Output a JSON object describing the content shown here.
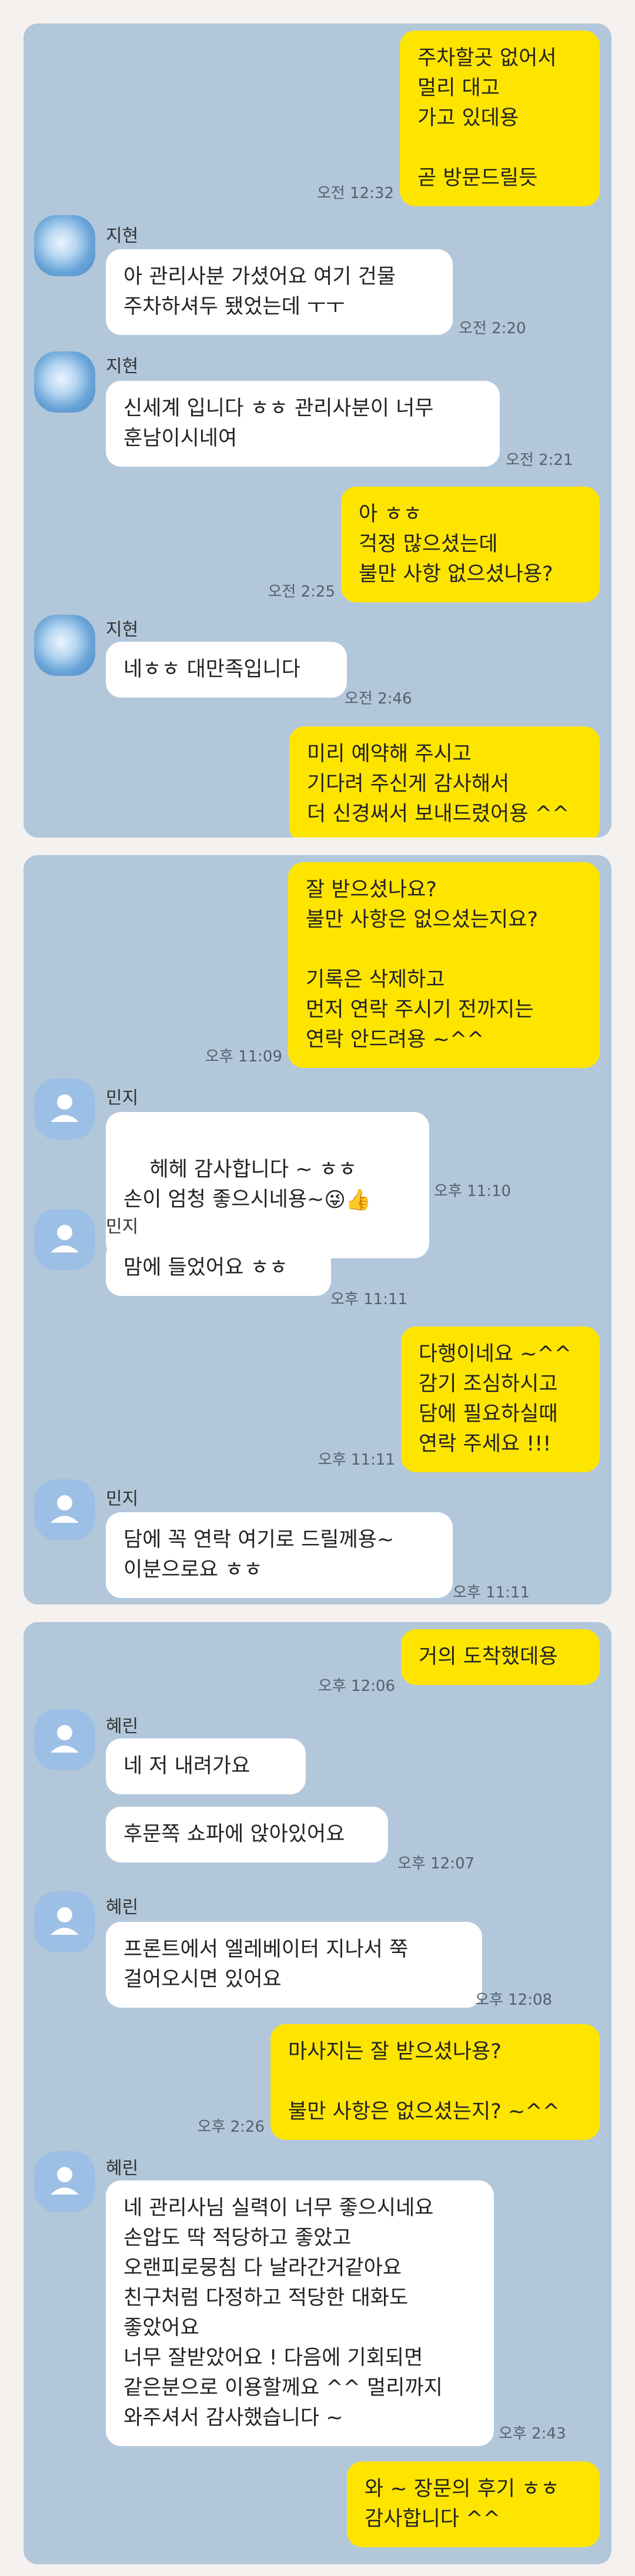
{
  "colors": {
    "page_bg": "#f5f1ee",
    "chat_bg": "#b2c7da",
    "my_bubble": "#fee500",
    "their_bubble": "#ffffff"
  },
  "sections": [
    {
      "messages": [
        {
          "from": "me",
          "text": "주차할곳 없어서\n멀리 대고\n가고 있데용\n\n곧 방문드릴듯",
          "time": "오전 12:32"
        },
        {
          "from": "them",
          "sender": "지현",
          "text": "아 관리사분 가셨어요 여기 건물\n주차하셔두 됐었는데 ㅜㅜ",
          "time": "오전 2:20"
        },
        {
          "from": "them",
          "sender": "지현",
          "text": "신세계 입니다 ㅎㅎ 관리사분이 너무\n훈남이시네여",
          "time": "오전 2:21"
        },
        {
          "from": "me",
          "text": "아 ㅎㅎ\n걱정 많으셨는데\n불만 사항 없으셨나용?",
          "time": "오전 2:25"
        },
        {
          "from": "them",
          "sender": "지현",
          "text": "네ㅎㅎ 대만족입니다",
          "time": "오전 2:46"
        },
        {
          "from": "me",
          "text": "미리 예약해 주시고\n기다려 주신게 감사해서\n더 신경써서 보내드렸어용 ^^",
          "time": ""
        }
      ]
    },
    {
      "messages": [
        {
          "from": "me",
          "text": "잘 받으셨나요?\n불만 사항은 없으셨는지요?\n\n기록은 삭제하고\n먼저 연락 주시기 전까지는\n연락 안드려용 ~^^",
          "time": "오후 11:09"
        },
        {
          "from": "them",
          "sender": "민지",
          "text": "헤헤 감사합니다 ~ ㅎㅎ\n손이 엄청 좋으시네용~",
          "emoji": "😜👍",
          "time": "오후 11:10"
        },
        {
          "from": "them",
          "sender": "민지",
          "text": "맘에 들었어요 ㅎㅎ",
          "time": "오후 11:11"
        },
        {
          "from": "me",
          "text": "다행이네요 ~^^\n감기 조심하시고\n담에 필요하실때\n연락 주세요 !!!",
          "time": "오후 11:11"
        },
        {
          "from": "them",
          "sender": "민지",
          "text": "담에 꼭 연락 여기로 드릴께용~\n이분으로요 ㅎㅎ",
          "time": "오후 11:11"
        }
      ]
    },
    {
      "messages": [
        {
          "from": "me",
          "text": "거의 도착했데용",
          "time": "오후 12:06"
        },
        {
          "from": "them",
          "sender": "혜린",
          "text": "네 저 내려가요",
          "time": ""
        },
        {
          "from": "them",
          "sender": "",
          "text": "후문쪽 쇼파에 앉아있어요",
          "time": "오후 12:07"
        },
        {
          "from": "them",
          "sender": "혜린",
          "text": "프론트에서 엘레베이터 지나서 쭉\n걸어오시면 있어요",
          "time": "오후 12:08"
        },
        {
          "from": "me",
          "text": "마사지는 잘 받으셨나용?\n\n불만 사항은 없으셨는지? ~^^",
          "time": "오후 2:26"
        },
        {
          "from": "them",
          "sender": "혜린",
          "text": "네 관리사님 실력이 너무 좋으시네요\n손압도 딱 적당하고 좋았고\n오랜피로뭉침 다 날라간거같아요\n친구처럼 다정하고 적당한 대화도\n좋았어요\n너무 잘받았어요 ! 다음에 기회되면\n같은분으로 이용할께요 ^^ 멀리까지\n와주셔서 감사했습니다 ~",
          "time": "오후 2:43"
        },
        {
          "from": "me",
          "text": "와 ~ 장문의 후기 ㅎㅎ\n감사합니다 ^^",
          "time": ""
        }
      ]
    }
  ]
}
